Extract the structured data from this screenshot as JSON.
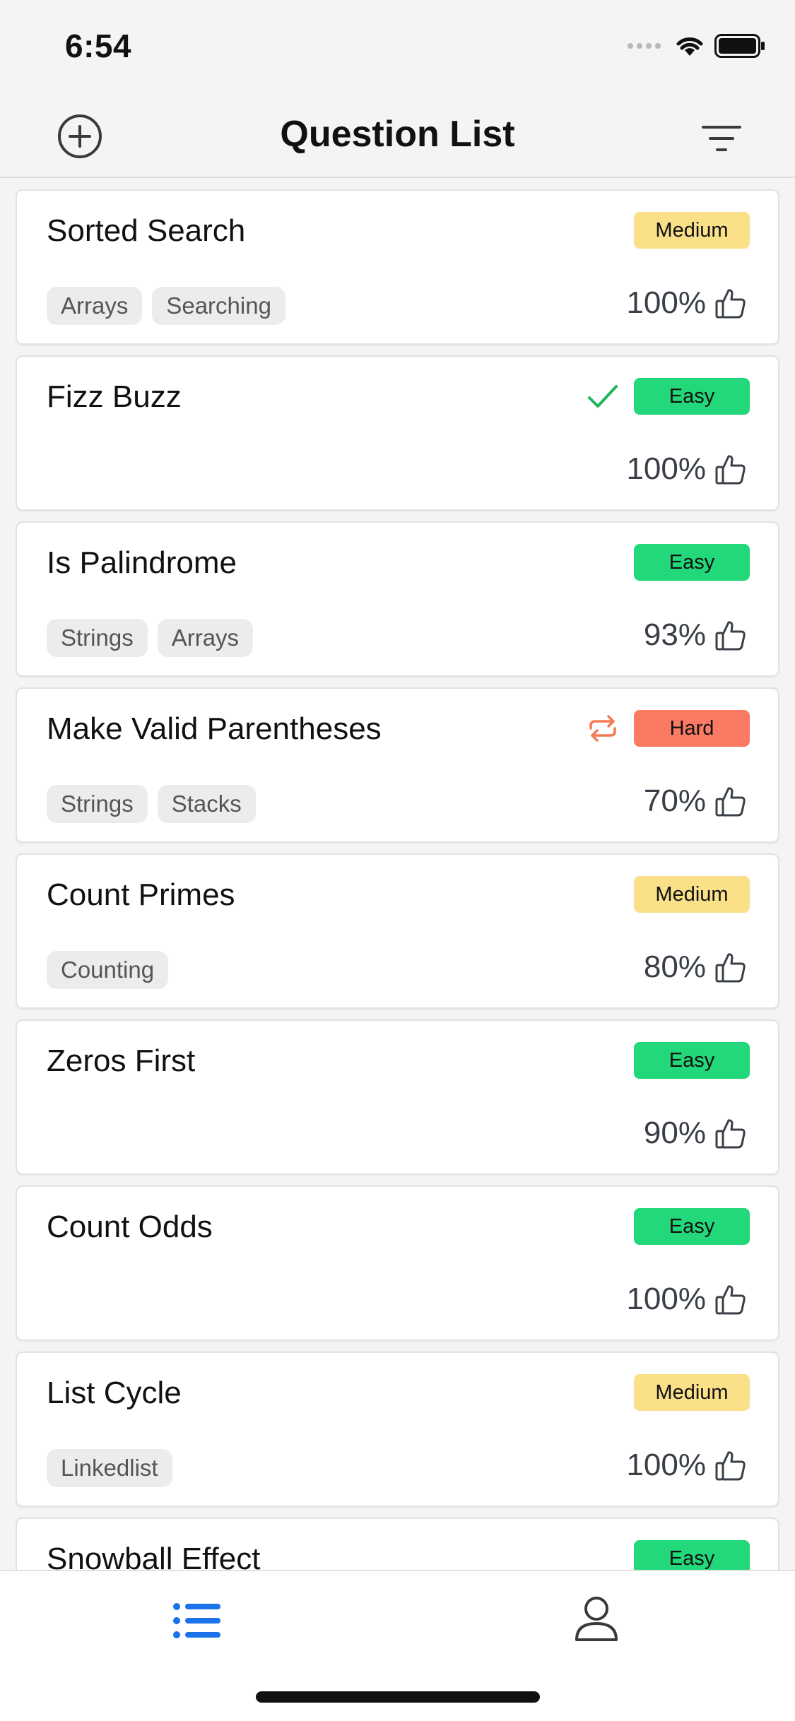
{
  "status_bar": {
    "time": "6:54"
  },
  "nav": {
    "title": "Question List",
    "add_icon": "plus-circle-icon",
    "filter_icon": "filter-icon"
  },
  "colors": {
    "easy": "#22d87a",
    "medium": "#fbe08a",
    "hard": "#fb7a63",
    "accent": "#1a73e8",
    "check": "#22b45c",
    "retry": "#f47a55"
  },
  "questions": [
    {
      "title": "Sorted Search",
      "difficulty": "Medium",
      "level": "medium",
      "status": "",
      "tags": [
        "Arrays",
        "Searching"
      ],
      "rating": "100%"
    },
    {
      "title": "Fizz Buzz",
      "difficulty": "Easy",
      "level": "easy",
      "status": "check",
      "tags": [],
      "rating": "100%"
    },
    {
      "title": "Is Palindrome",
      "difficulty": "Easy",
      "level": "easy",
      "status": "",
      "tags": [
        "Strings",
        "Arrays"
      ],
      "rating": "93%"
    },
    {
      "title": "Make Valid Parentheses",
      "difficulty": "Hard",
      "level": "hard",
      "status": "retry",
      "tags": [
        "Strings",
        "Stacks"
      ],
      "rating": "70%"
    },
    {
      "title": "Count Primes",
      "difficulty": "Medium",
      "level": "medium",
      "status": "",
      "tags": [
        "Counting"
      ],
      "rating": "80%"
    },
    {
      "title": "Zeros First",
      "difficulty": "Easy",
      "level": "easy",
      "status": "",
      "tags": [],
      "rating": "90%"
    },
    {
      "title": "Count Odds",
      "difficulty": "Easy",
      "level": "easy",
      "status": "",
      "tags": [],
      "rating": "100%"
    },
    {
      "title": "List Cycle",
      "difficulty": "Medium",
      "level": "medium",
      "status": "",
      "tags": [
        "Linkedlist"
      ],
      "rating": "100%"
    },
    {
      "title": "Snowball Effect",
      "difficulty": "Easy",
      "level": "easy",
      "status": "",
      "tags": [],
      "rating": ""
    }
  ],
  "tab_bar": {
    "tabs": [
      {
        "icon": "list-icon",
        "active": true
      },
      {
        "icon": "profile-icon",
        "active": false
      }
    ]
  }
}
